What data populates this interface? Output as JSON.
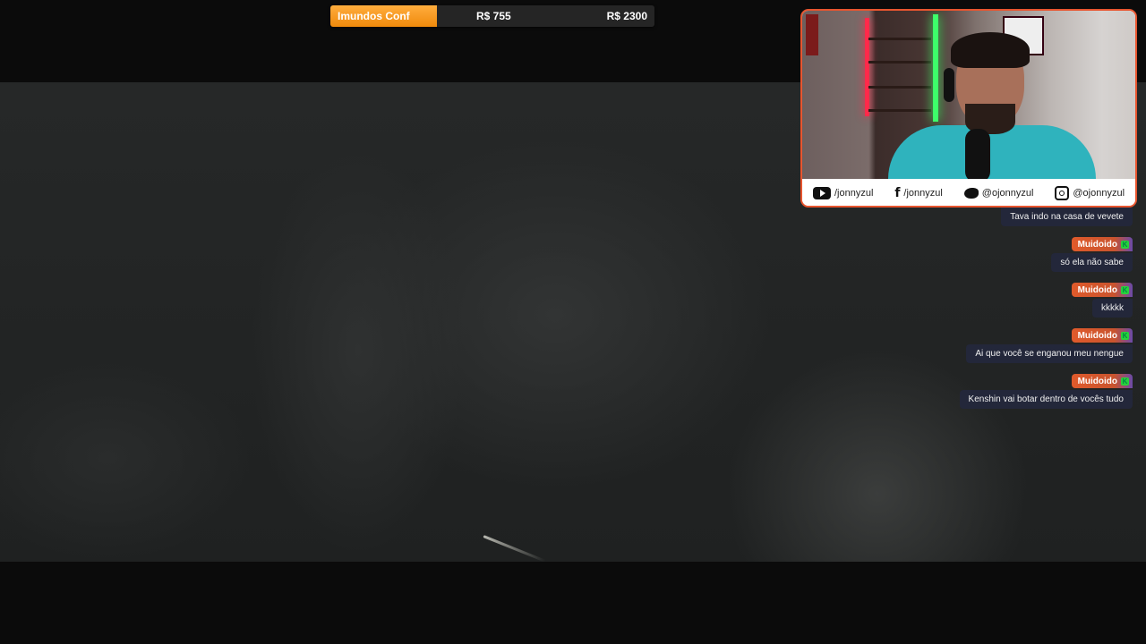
{
  "goal": {
    "name": "Imundos Conf",
    "current": "R$ 755",
    "target": "R$ 2300",
    "progress_percent": 33,
    "fill_color": "#f39417"
  },
  "webcam": {
    "border_color": "#e8552f",
    "socials": [
      {
        "icon": "youtube-icon",
        "handle": "/jonnyzul"
      },
      {
        "icon": "facebook-icon",
        "handle": "/jonnyzul"
      },
      {
        "icon": "twitter-icon",
        "handle": "@ojonnyzul"
      },
      {
        "icon": "instagram-icon",
        "handle": "@ojonnyzul"
      }
    ]
  },
  "chat": {
    "messages": [
      {
        "user": "",
        "text": "Tava indo na casa de vevete"
      },
      {
        "user": "Muidoido",
        "text": "só ela não sabe"
      },
      {
        "user": "Muidoido",
        "text": "kkkkk"
      },
      {
        "user": "Muidoido",
        "text": "Ai que você se enganou meu nengue"
      },
      {
        "user": "Muidoido",
        "text": "Kenshin vai botar dentro de vocês tudo"
      }
    ],
    "badge_icon": "kick-badge-icon",
    "badge_color": "#27d33b",
    "badge_glyph": "K"
  }
}
